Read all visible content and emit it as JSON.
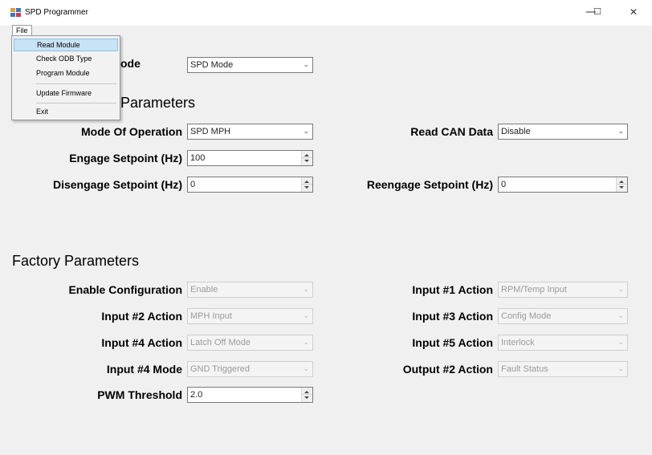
{
  "window": {
    "title": "SPD Programmer",
    "min": "—",
    "max": "☐",
    "close": "✕"
  },
  "menu": {
    "file": "File",
    "items": [
      "Read Module",
      "Check ODB Type",
      "Program Module",
      "Update Firmware",
      "Exit"
    ]
  },
  "mode": {
    "label_partial": "ode",
    "value": "SPD Mode"
  },
  "params": {
    "title_partial": "Parameters",
    "mode_of_operation": {
      "label": "Mode Of Operation",
      "value": "SPD MPH"
    },
    "engage": {
      "label": "Engage Setpoint (Hz)",
      "value": "100"
    },
    "disengage": {
      "label": "Disengage Setpoint (Hz)",
      "value": "0"
    },
    "read_can": {
      "label": "Read CAN Data",
      "value": "Disable"
    },
    "reengage": {
      "label": "Reengage Setpoint (Hz)",
      "value": "0"
    }
  },
  "factory": {
    "title": "Factory Parameters",
    "enable_config": {
      "label": "Enable Configuration",
      "value": "Enable"
    },
    "input2": {
      "label": "Input #2 Action",
      "value": "MPH Input"
    },
    "input4": {
      "label": "Input #4 Action",
      "value": "Latch Off Mode"
    },
    "input4_mode": {
      "label": "Input #4 Mode",
      "value": "GND Triggered"
    },
    "pwm": {
      "label": "PWM Threshold",
      "value": "2.0"
    },
    "input1": {
      "label": "Input #1 Action",
      "value": "RPM/Temp Input"
    },
    "input3": {
      "label": "Input #3 Action",
      "value": "Config Mode"
    },
    "input5": {
      "label": "Input #5 Action",
      "value": "Interlock"
    },
    "output2": {
      "label": "Output #2 Action",
      "value": "Fault Status"
    }
  },
  "icons": {
    "dropdown": "chevron-down-icon",
    "spinner": "spinner-arrows-icon",
    "app": "app-icon"
  }
}
